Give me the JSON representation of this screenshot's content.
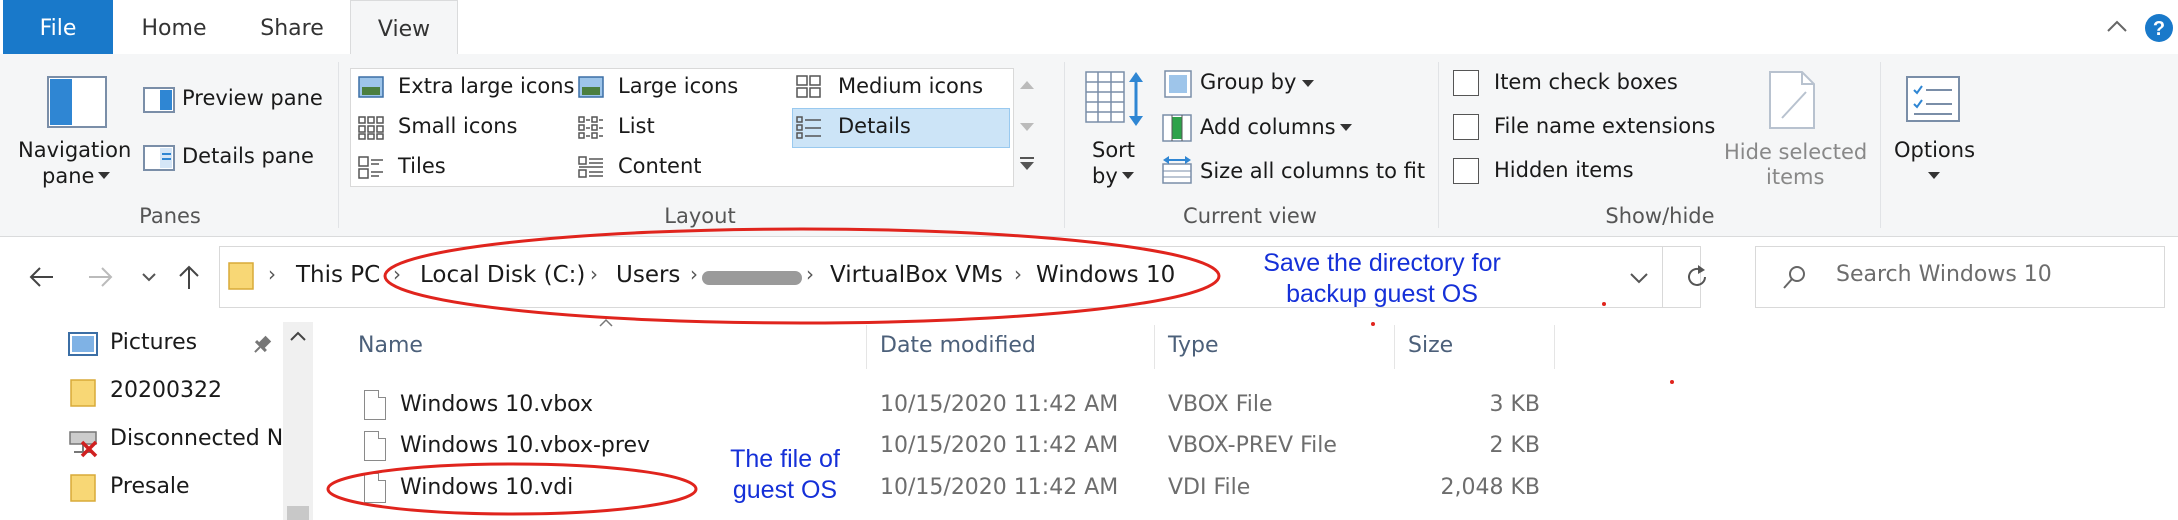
{
  "ribbon_tabs": {
    "file": "File",
    "home": "Home",
    "share": "Share",
    "view": "View"
  },
  "panes": {
    "group_label": "Panes",
    "navigation_pane_line1": "Navigation",
    "navigation_pane_line2": "pane",
    "preview_pane": "Preview pane",
    "details_pane": "Details pane"
  },
  "layout": {
    "group_label": "Layout",
    "extra_large_icons": "Extra large icons",
    "large_icons": "Large icons",
    "medium_icons": "Medium icons",
    "small_icons": "Small icons",
    "list": "List",
    "details": "Details",
    "tiles": "Tiles",
    "content": "Content"
  },
  "current_view": {
    "group_label": "Current view",
    "sort_line1": "Sort",
    "sort_line2": "by",
    "group_by": "Group by",
    "add_columns": "Add columns",
    "size_all_columns": "Size all columns to fit"
  },
  "show_hide": {
    "group_label": "Show/hide",
    "item_check_boxes": "Item check boxes",
    "file_name_extensions": "File name extensions",
    "hidden_items": "Hidden items",
    "hide_selected_line1": "Hide selected",
    "hide_selected_line2": "items"
  },
  "options": {
    "label": "Options"
  },
  "address": {
    "crumbs": [
      "This PC",
      "Local Disk (C:)",
      "Users",
      "VirtualBox VMs",
      "Windows 10"
    ],
    "search_placeholder": "Search Windows 10"
  },
  "nav_pane": {
    "items": [
      {
        "label": "Pictures",
        "icon": "pictures-icon"
      },
      {
        "label": "20200322",
        "icon": "folder-icon"
      },
      {
        "label": "Disconnected N",
        "icon": "disconnected-drive-icon"
      },
      {
        "label": "Presale",
        "icon": "folder-icon"
      }
    ]
  },
  "file_list": {
    "columns": {
      "name": "Name",
      "date_modified": "Date modified",
      "type": "Type",
      "size": "Size"
    },
    "rows": [
      {
        "name": "Windows 10.vbox",
        "date": "10/15/2020 11:42 AM",
        "type": "VBOX File",
        "size": "3 KB"
      },
      {
        "name": "Windows 10.vbox-prev",
        "date": "10/15/2020 11:42 AM",
        "type": "VBOX-PREV File",
        "size": "2 KB"
      },
      {
        "name": "Windows 10.vdi",
        "date": "10/15/2020 11:42 AM",
        "type": "VDI File",
        "size": "2,048 KB"
      }
    ]
  },
  "annotations": {
    "directory_line1": "Save the directory for",
    "directory_line2": "backup guest OS",
    "file_line1": "The file of",
    "file_line2": "guest OS"
  },
  "colors": {
    "accent": "#1979ca",
    "annotation_ellipse": "#e0241d",
    "annotation_text": "#1530d8"
  }
}
